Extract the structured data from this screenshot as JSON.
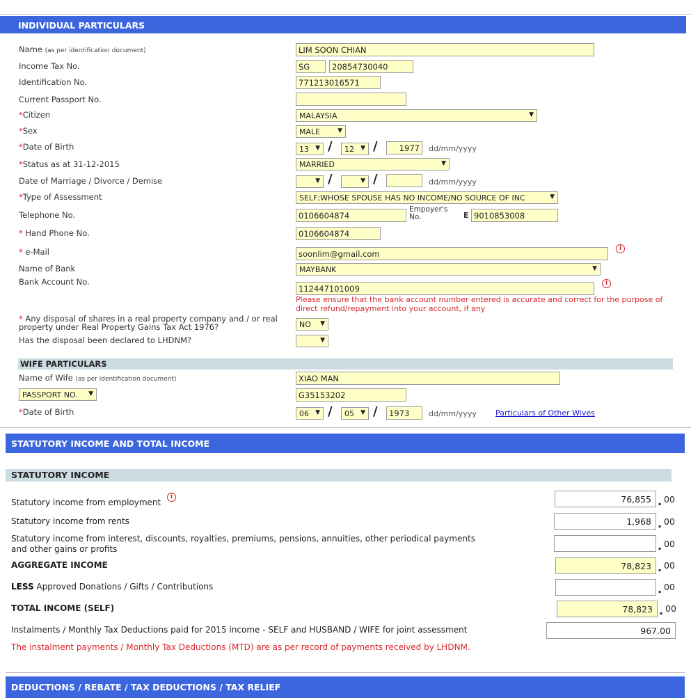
{
  "section_individual": {
    "title": "INDIVIDUAL PARTICULARS",
    "name_label": "Name",
    "name_note": "(as per identification document)",
    "name_value": "LIM SOON CHIAN",
    "tax_no_label": "Income Tax No.",
    "tax_prefix": "SG",
    "tax_no_value": "20854730040",
    "id_label": "Identification No.",
    "id_value": "771213016571",
    "passport_label": "Current Passport No.",
    "passport_value": "",
    "citizen_label": "Citizen",
    "citizen_value": "MALAYSIA",
    "sex_label": "Sex",
    "sex_value": "MALE",
    "dob_label": "Date of Birth",
    "dob_day": "13",
    "dob_month": "12",
    "dob_year": "1977",
    "date_hint": "dd/mm/yyyy",
    "status_label": "Status as at 31-12-2015",
    "status_value": "MARRIED",
    "marriage_label": "Date of Marriage / Divorce / Demise",
    "assessment_label": "Type of Assessment",
    "assessment_value": "SELF;WHOSE SPOUSE HAS NO INCOME/NO SOURCE OF INC",
    "phone_label": "Telephone No.",
    "phone_value": "0106604874",
    "employer_label": "Empoyer's No.",
    "employer_prefix": "E",
    "employer_value": "9010853008",
    "hp_label": "Hand Phone No.",
    "hp_value": "0106604874",
    "email_label": "e-Mail",
    "email_value": "soonlim@gmail.com",
    "bank_label": "Name of Bank",
    "bank_value": "MAYBANK",
    "account_label": "Bank Account No.",
    "account_value": "112447101009",
    "account_warning": "Please ensure that the bank account number entered is accurate and correct for the purpose of direct refund/repayment into your account, if any",
    "disposal_label": "Any disposal of shares in a real property company and / or real property under Real Property Gains Tax Act 1976?",
    "disposal_value": "NO",
    "declared_label": "Has the disposal been declared to LHDNM?",
    "declared_value": ""
  },
  "section_wife": {
    "title": "WIFE PARTICULARS",
    "name_label": "Name of Wife",
    "name_note": "(as per identification document)",
    "name_value": "XIAO MAN",
    "id_type": "PASSPORT NO.",
    "id_value": "G35153202",
    "dob_label": "Date of Birth",
    "dob_day": "06",
    "dob_month": "05",
    "dob_year": "1973",
    "date_hint": "dd/mm/yyyy",
    "other_wives_link": "Particulars of Other Wives"
  },
  "section_income": {
    "title": "STATUTORY INCOME AND TOTAL INCOME",
    "subtitle": "STATUTORY INCOME",
    "employment_label": "Statutory income from employment",
    "employment_value": "76,855",
    "rents_label": "Statutory income from rents",
    "rents_value": "1,968",
    "interest_label": "Statutory income from interest, discounts, royalties, premiums, pensions, annuities, other periodical payments and other gains or profits",
    "interest_value": "",
    "aggregate_label": "AGGREGATE INCOME",
    "aggregate_value": "78,823",
    "less_bold": "LESS",
    "less_label": "Approved Donations / Gifts / Contributions",
    "less_value": "",
    "total_label": "TOTAL INCOME (SELF)",
    "total_value": "78,823",
    "cents": "00",
    "mtd_label": "Instalments / Monthly Tax Deductions paid for 2015 income - SELF and HUSBAND / WIFE for joint assessment",
    "mtd_value": "967.00",
    "mtd_note": "The instalment payments / Monthly Tax Deductions (MTD) are as per record of payments received by LHDNM."
  },
  "section_deductions": {
    "title": "DEDUCTIONS / REBATE / TAX DEDUCTIONS / TAX RELIEF"
  },
  "icons": {
    "info": "info-icon",
    "dropdown": "chevron-down-icon"
  },
  "symbols": {
    "asterisk": "*",
    "slash": "/",
    "info": "i",
    "arrow": "▼",
    "dot": "."
  }
}
